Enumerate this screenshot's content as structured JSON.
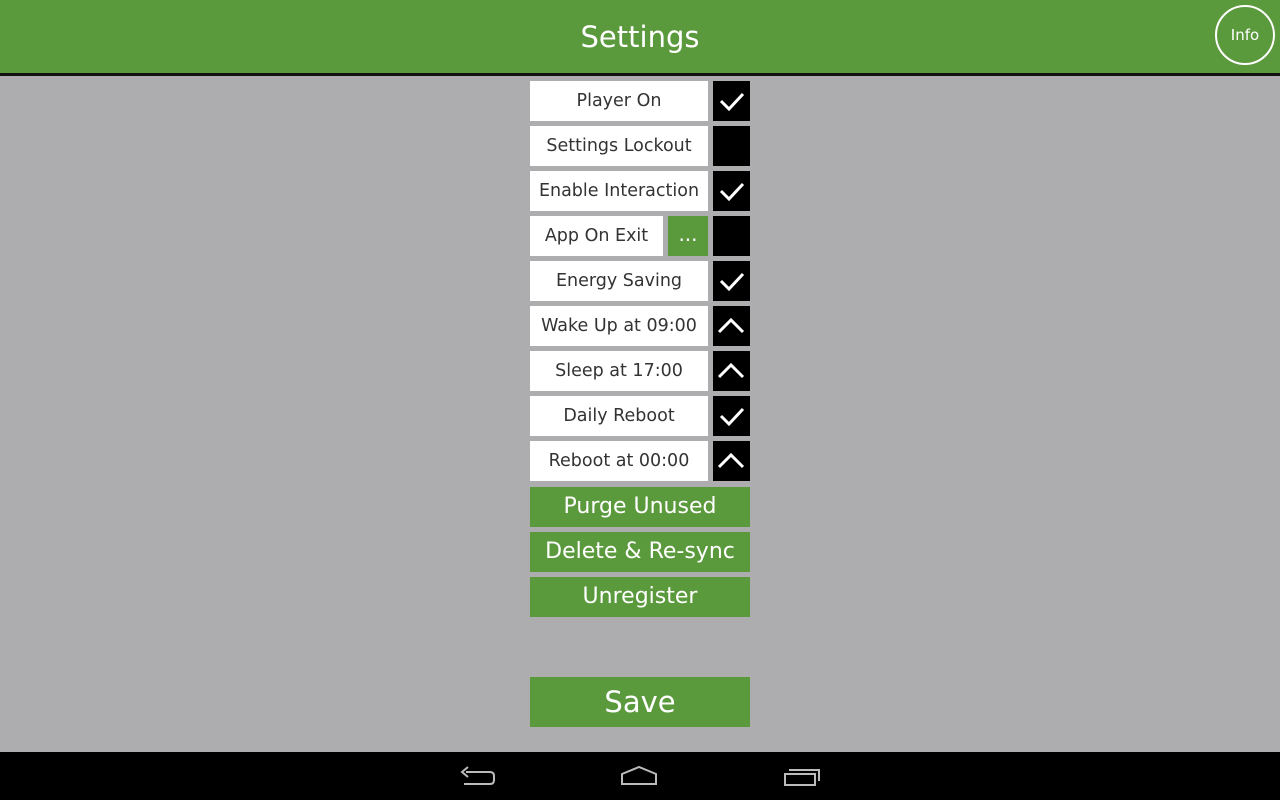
{
  "header": {
    "title": "Settings",
    "info_label": "Info"
  },
  "settings": [
    {
      "label": "Player On",
      "state": "checked"
    },
    {
      "label": "Settings Lockout",
      "state": "unchecked"
    },
    {
      "label": "Enable Interaction",
      "state": "checked"
    },
    {
      "label": "App On Exit",
      "state": "unchecked",
      "more_label": "..."
    },
    {
      "label": "Energy Saving",
      "state": "checked"
    },
    {
      "label": "Wake Up at 09:00",
      "state": "expand"
    },
    {
      "label": "Sleep at 17:00",
      "state": "expand"
    },
    {
      "label": "Daily Reboot",
      "state": "checked"
    },
    {
      "label": "Reboot at 00:00",
      "state": "expand"
    }
  ],
  "actions": {
    "purge_label": "Purge Unused",
    "delete_label": "Delete & Re-sync",
    "unregister_label": "Unregister",
    "save_label": "Save"
  },
  "navbar": {
    "icons": [
      "back-icon",
      "home-icon",
      "recent-apps-icon"
    ]
  },
  "colors": {
    "accent": "#5b993d",
    "background": "#adacae",
    "toggle": "#000000"
  }
}
